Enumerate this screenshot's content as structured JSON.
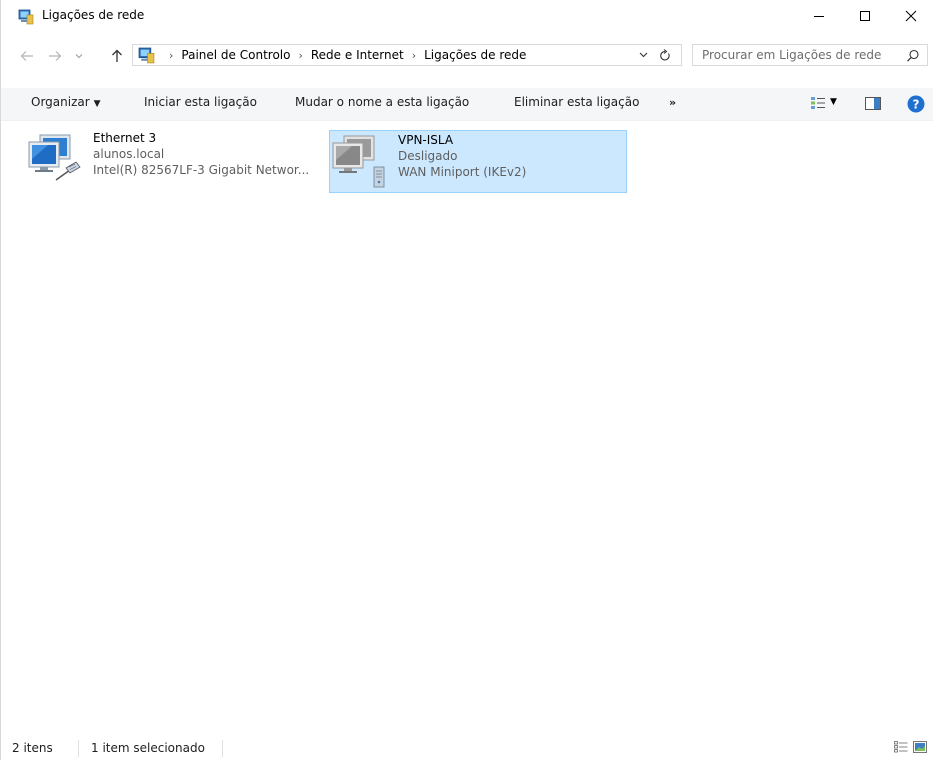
{
  "window": {
    "title": "Ligações de rede",
    "icons": {
      "app": "network-connections-icon",
      "minimize": "minimize-icon",
      "maximize": "maximize-icon",
      "close": "close-icon"
    }
  },
  "navigation": {
    "back_icon": "arrow-left-icon",
    "forward_icon": "arrow-right-icon",
    "recent_icon": "chevron-down-icon",
    "up_icon": "arrow-up-icon"
  },
  "address": {
    "breadcrumbs": [
      "Painel de Controlo",
      "Rede e Internet",
      "Ligações de rede"
    ],
    "separator": "›",
    "dropdown_icon": "chevron-down-icon",
    "refresh_icon": "refresh-icon"
  },
  "search": {
    "placeholder": "Procurar em Ligações de rede",
    "icon": "search-icon"
  },
  "commands": {
    "organize": "Organizar",
    "start": "Iniciar esta ligação",
    "rename": "Mudar o nome a esta ligação",
    "delete": "Eliminar esta ligação",
    "more": "»",
    "view_icon": "change-view-icon",
    "preview_pane_icon": "preview-pane-icon",
    "help_icon": "help-icon",
    "help_label": "?"
  },
  "connections": [
    {
      "name": "Ethernet 3",
      "status": "alunos.local",
      "device": "Intel(R) 82567LF-3 Gigabit Networ...",
      "icon": "ethernet-adapter-icon",
      "selected": false
    },
    {
      "name": "VPN-ISLA",
      "status": "Desligado",
      "device": "WAN Miniport (IKEv2)",
      "icon": "vpn-adapter-icon",
      "selected": true
    }
  ],
  "statusbar": {
    "count": "2 itens",
    "selection": "1 item selecionado",
    "details_view_icon": "details-view-icon",
    "tiles_view_icon": "large-icons-view-icon"
  },
  "colors": {
    "selection_bg": "#cce8ff",
    "selection_border": "#99d1ff",
    "help_blue": "#1e6fd0"
  }
}
